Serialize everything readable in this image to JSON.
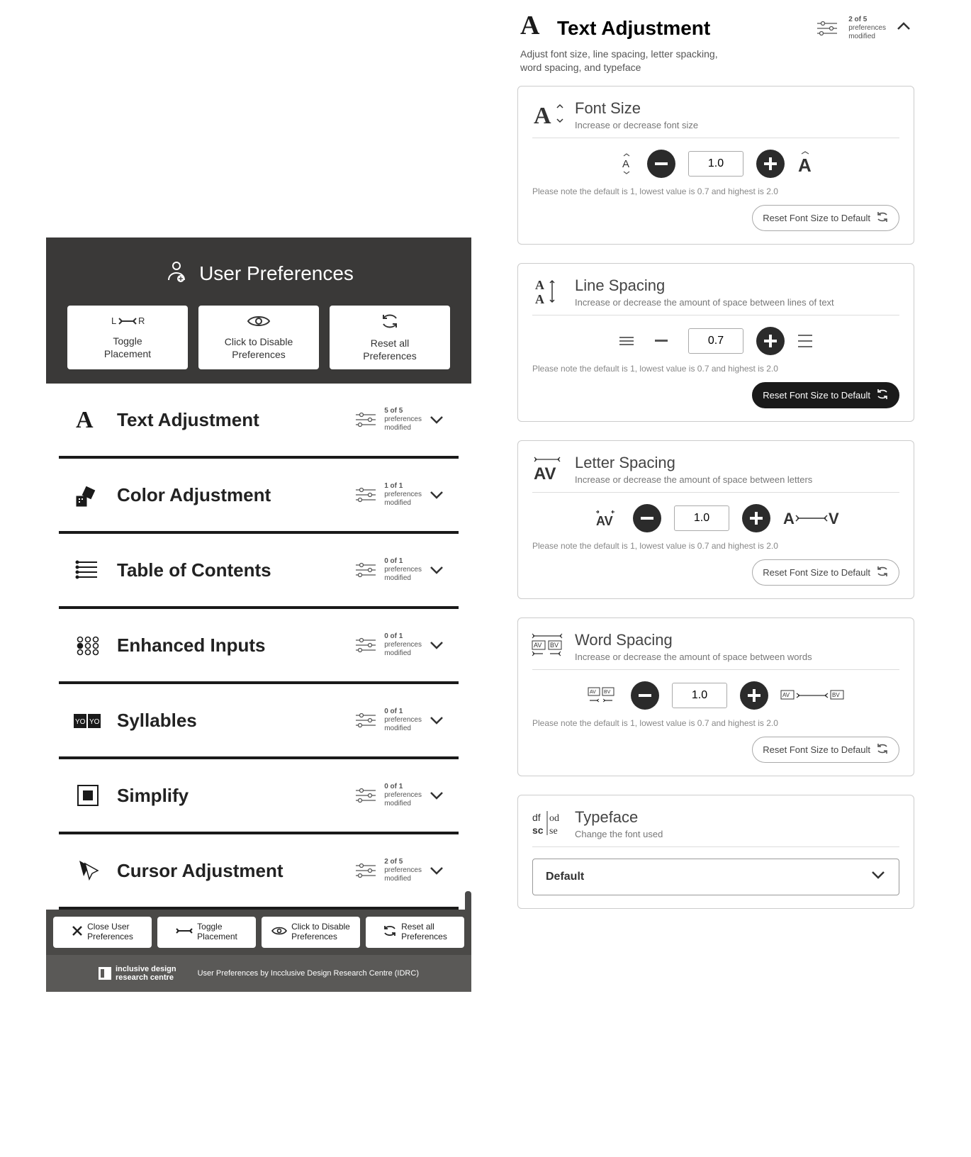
{
  "left": {
    "title": "User Preferences",
    "buttons": {
      "toggle": "Toggle\nPlacement",
      "disable": "Click to Disable\nPreferences",
      "reset": "Reset all\nPreferences"
    },
    "items": [
      {
        "title": "Text Adjustment",
        "count": "5 of 5",
        "meta": "preferences\nmodified"
      },
      {
        "title": "Color Adjustment",
        "count": "1 of 1",
        "meta": "preferences\nmodified"
      },
      {
        "title": "Table of Contents",
        "count": "0 of 1",
        "meta": "preferences\nmodified"
      },
      {
        "title": "Enhanced Inputs",
        "count": "0 of 1",
        "meta": "preferences\nmodified"
      },
      {
        "title": "Syllables",
        "count": "0 of 1",
        "meta": "preferences\nmodified"
      },
      {
        "title": "Simplify",
        "count": "0 of 1",
        "meta": "preferences\nmodified"
      },
      {
        "title": "Cursor Adjustment",
        "count": "2 of 5",
        "meta": "preferences\nmodified"
      }
    ],
    "footer_buttons": {
      "close": "Close User\nPreferences",
      "toggle": "Toggle\nPlacement",
      "disable": "Click to Disable\nPreferences",
      "reset": "Reset all\nPreferences"
    },
    "credit_org": "inclusive design\nresearch centre",
    "credit_line": "User Preferences by Incclusive Design Research Centre (IDRC)"
  },
  "right": {
    "title": "Text Adjustment",
    "meta_count": "2 of 5",
    "meta_label": "preferences\nmodified",
    "subtitle": "Adjust font size, line spacing, letter spacking,\nword spacing, and typeface",
    "cards": [
      {
        "title": "Font Size",
        "desc": "Increase or decrease font size",
        "value": "1.0",
        "note": "Please note the default is 1, lowest value is 0.7 and highest is 2.0",
        "reset": "Reset Font Size to Default",
        "reset_dark": false,
        "minus_dark": true,
        "plus_dark": true
      },
      {
        "title": "Line Spacing",
        "desc": "Increase or decrease the amount of space between lines of text",
        "value": "0.7",
        "note": "Please note the default is 1, lowest value is 0.7 and highest is 2.0",
        "reset": "Reset Font Size to Default",
        "reset_dark": true,
        "minus_dark": false,
        "plus_dark": true
      },
      {
        "title": "Letter Spacing",
        "desc": "Increase or decrease the amount of space between letters",
        "value": "1.0",
        "note": "Please note the default is 1, lowest value is 0.7 and highest is 2.0",
        "reset": "Reset Font Size to Default",
        "reset_dark": false,
        "minus_dark": true,
        "plus_dark": true
      },
      {
        "title": "Word Spacing",
        "desc": "Increase or decrease the amount of space between words",
        "value": "1.0",
        "note": "Please note the default is 1, lowest value is 0.7 and highest is 2.0",
        "reset": "Reset Font Size to Default",
        "reset_dark": false,
        "minus_dark": true,
        "plus_dark": true
      },
      {
        "title": "Typeface",
        "desc": "Change the font used",
        "selected": "Default"
      }
    ]
  }
}
